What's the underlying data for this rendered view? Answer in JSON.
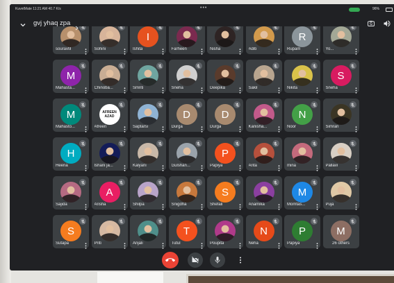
{
  "status_bar": {
    "left_text": "KuvetMate 11:21 AM 40.7 K/s",
    "center_text": "•••",
    "battery_text": "96%",
    "indicator_icon": "call-indicator-pill",
    "battery_icon": "battery-icon"
  },
  "header": {
    "chevron_icon": "chevron-down-icon",
    "meeting_code": "gvj yhaq zpa",
    "icons": [
      "camera-flip-icon",
      "speaker-icon"
    ]
  },
  "participants": [
    {
      "name": "souravtil",
      "kind": "photo",
      "color": "#b7906c"
    },
    {
      "name": "Sohini",
      "kind": "photo",
      "color": "#d7b49a"
    },
    {
      "name": "Ishita",
      "kind": "letter",
      "letter": "I",
      "color": "#e6521f"
    },
    {
      "name": "Farheen",
      "kind": "photo",
      "color": "#7b2a4f"
    },
    {
      "name": "Nisha",
      "kind": "photo",
      "color": "#2e2424"
    },
    {
      "name": "Aditi",
      "kind": "photo",
      "color": "#d29a4c"
    },
    {
      "name": "Rupam",
      "kind": "letter",
      "letter": "R",
      "color": "#8b959b"
    },
    {
      "name": "Yo...",
      "kind": "photo",
      "color": "#a3a896"
    },
    {
      "name": "Mahasta...",
      "kind": "letter",
      "letter": "M",
      "color": "#8e24aa"
    },
    {
      "name": "Chinoba...",
      "kind": "photo",
      "color": "#c9ad94"
    },
    {
      "name": "Smriti",
      "kind": "photo",
      "color": "#6fa5a0"
    },
    {
      "name": "Sneha",
      "kind": "photo",
      "color": "#cfcfcf"
    },
    {
      "name": "Deepika",
      "kind": "photo",
      "color": "#5a3b2c"
    },
    {
      "name": "Sakil",
      "kind": "photo",
      "color": "#b8a58f"
    },
    {
      "name": "Nikita",
      "kind": "photo",
      "color": "#d9c24a"
    },
    {
      "name": "Sneha",
      "kind": "letter",
      "letter": "S",
      "color": "#d81b60"
    },
    {
      "name": "Mahasto...",
      "kind": "letter",
      "letter": "M",
      "color": "#00897b"
    },
    {
      "name": "Afreen",
      "kind": "text",
      "label": "AFREEN AZAD",
      "color": "#ffffff"
    },
    {
      "name": "Saptarsi",
      "kind": "photo",
      "color": "#8fb3d4"
    },
    {
      "name": "Durga",
      "kind": "letter",
      "letter": "D",
      "color": "#a88a6f"
    },
    {
      "name": "Durga",
      "kind": "letter",
      "letter": "D",
      "color": "#a88a6f"
    },
    {
      "name": "Kanisha...",
      "kind": "photo",
      "color": "#c25a8a"
    },
    {
      "name": "Noor",
      "kind": "letter",
      "letter": "N",
      "color": "#43a047"
    },
    {
      "name": "Simran",
      "kind": "photo",
      "color": "#3b3524"
    },
    {
      "name": "Heena",
      "kind": "letter",
      "letter": "H",
      "color": "#00acc1"
    },
    {
      "name": "Ishani ja...",
      "kind": "photo",
      "color": "#141c58"
    },
    {
      "name": "Kalyani",
      "kind": "photo",
      "color": "#c8b8a8"
    },
    {
      "name": "Gulshan...",
      "kind": "photo",
      "color": "#9aa3ab"
    },
    {
      "name": "Papiya",
      "kind": "letter",
      "letter": "P",
      "color": "#f4511e"
    },
    {
      "name": "Arita",
      "kind": "photo",
      "color": "#b6503c"
    },
    {
      "name": "mina",
      "kind": "photo",
      "color": "#c46a7c"
    },
    {
      "name": "Pallavi",
      "kind": "photo",
      "color": "#d8cfc4"
    },
    {
      "name": "Sajida",
      "kind": "photo",
      "color": "#b66a82"
    },
    {
      "name": "Arisha",
      "kind": "letter",
      "letter": "A",
      "color": "#e91e63"
    },
    {
      "name": "Shilpa",
      "kind": "photo",
      "color": "#b9a4c9"
    },
    {
      "name": "Snigdha",
      "kind": "photo",
      "color": "#c7783c"
    },
    {
      "name": "Shefali",
      "kind": "letter",
      "letter": "S",
      "color": "#f57c1f"
    },
    {
      "name": "Anamika",
      "kind": "photo",
      "color": "#8b3fa0"
    },
    {
      "name": "Momtas...",
      "kind": "letter",
      "letter": "M",
      "color": "#1e88e5"
    },
    {
      "name": "Puja",
      "kind": "photo",
      "color": "#e0c9a6"
    },
    {
      "name": "Sutapa",
      "kind": "letter",
      "letter": "S",
      "color": "#f57c1f"
    },
    {
      "name": "Priti",
      "kind": "photo",
      "color": "#d6b9a2"
    },
    {
      "name": "Anjali",
      "kind": "photo",
      "color": "#4f8f8a"
    },
    {
      "name": "Tutul",
      "kind": "letter",
      "letter": "T",
      "color": "#f4511e"
    },
    {
      "name": "Poupita",
      "kind": "photo",
      "color": "#b03a8a"
    },
    {
      "name": "Neha",
      "kind": "letter",
      "letter": "N",
      "color": "#e64a19"
    },
    {
      "name": "Papiya",
      "kind": "letter",
      "letter": "P",
      "color": "#2e7d32"
    },
    {
      "name": "26 others",
      "kind": "letter",
      "letter": "M",
      "color": "#8d6e63",
      "overflow_tile": true
    }
  ],
  "tile_icons": {
    "muted": "mic-off-icon",
    "menu": "more-options-icon"
  },
  "controls": {
    "end_call": {
      "icon": "phone-hangup-icon"
    },
    "camera": {
      "icon": "camera-off-icon"
    },
    "mic": {
      "icon": "mic-icon"
    },
    "more": {
      "icon": "more-vert-icon"
    }
  },
  "colors": {
    "screen_bg": "#202124",
    "tile_bg": "#3c4043",
    "badge_bg": "#5f6368",
    "end_call": "#ea4335",
    "ctrl_bg": "#3c4043",
    "indicator": "#34a853"
  }
}
